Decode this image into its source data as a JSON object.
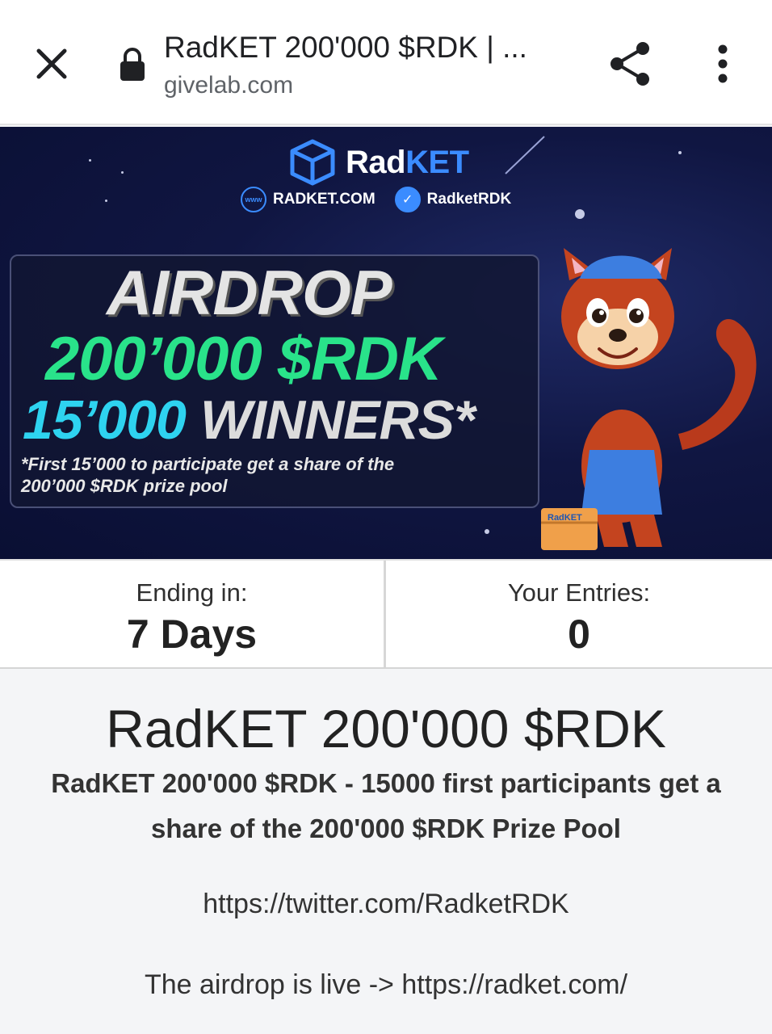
{
  "browser": {
    "page_title": "RadKET 200'000 $RDK | ...",
    "domain": "givelab.com",
    "icons": {
      "close": "close-icon",
      "lock": "lock-icon",
      "share": "share-icon",
      "menu": "more-vert-icon"
    }
  },
  "banner": {
    "brand_prefix": "Rad",
    "brand_suffix": "KET",
    "website_badge": "www",
    "website": "RADKET.COM",
    "twitter_handle": "RadketRDK",
    "airdrop": "AIRDROP",
    "amount": "200’000 $RDK",
    "winners_number": "15’000",
    "winners_word": "WINNERS*",
    "note": "*First 15’000 to participate get a share of the 200’000 $RDK prize pool",
    "box_label": "RadKET",
    "colors": {
      "background": "#101642",
      "green": "#29e38a",
      "cyan": "#2ed3f0",
      "brand_blue": "#3b8cff"
    }
  },
  "stats": {
    "ending_label": "Ending in:",
    "ending_value": "7 Days",
    "entries_label": "Your Entries:",
    "entries_value": "0"
  },
  "content": {
    "title": "RadKET 200'000 $RDK",
    "subtitle": "RadKET 200'000 $RDK - 15000 first participants get a share of the 200'000 $RDK Prize Pool",
    "twitter_link": "https://twitter.com/RadketRDK",
    "live_text": "The airdrop is live -> https://radket.com/"
  }
}
